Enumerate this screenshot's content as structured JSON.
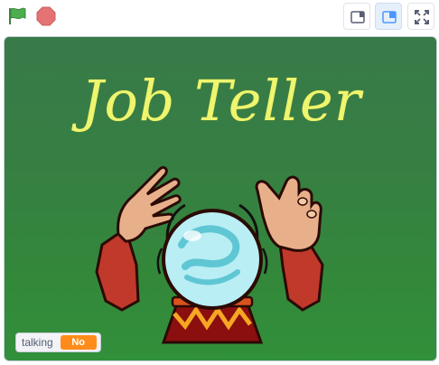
{
  "toolbar": {
    "green_flag_color": "#4cae4c",
    "stop_color": "#e57373",
    "buttons": [
      "small-stage",
      "normal-stage",
      "fullscreen"
    ]
  },
  "stage": {
    "title": "Job Teller"
  },
  "monitor": {
    "label": "talking",
    "value": "No"
  },
  "colors": {
    "accent": "#4c97ff",
    "title": "#eef56e",
    "monitor_value": "#ff8c1a"
  }
}
